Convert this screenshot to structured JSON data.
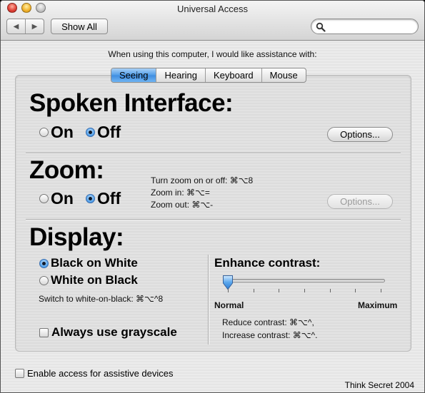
{
  "window": {
    "title": "Universal Access"
  },
  "toolbar": {
    "back_glyph": "◀",
    "forward_glyph": "▶",
    "show_all_label": "Show All",
    "search_placeholder": ""
  },
  "intro_text": "When using this computer, I would like assistance with:",
  "tabs": [
    {
      "label": "Seeing",
      "active": true
    },
    {
      "label": "Hearing",
      "active": false
    },
    {
      "label": "Keyboard",
      "active": false
    },
    {
      "label": "Mouse",
      "active": false
    }
  ],
  "spoken_interface": {
    "heading": "Spoken Interface:",
    "on_label": "On",
    "off_label": "Off",
    "selected": "off",
    "options_label": "Options..."
  },
  "zoom": {
    "heading": "Zoom:",
    "on_label": "On",
    "off_label": "Off",
    "selected": "off",
    "shortcut_toggle": "Turn zoom on or off: ⌘⌥8",
    "shortcut_in": "Zoom in: ⌘⌥=",
    "shortcut_out": "Zoom out: ⌘⌥-",
    "options_label": "Options...",
    "options_enabled": false
  },
  "display": {
    "heading": "Display:",
    "black_on_white_label": "Black on White",
    "white_on_black_label": "White on Black",
    "selected": "black-on-white",
    "switch_shortcut": "Switch to white-on-black: ⌘⌥^8",
    "grayscale_label": "Always use grayscale",
    "grayscale_checked": false
  },
  "enhance_contrast": {
    "heading": "Enhance contrast:",
    "min_label": "Normal",
    "max_label": "Maximum",
    "value": 0,
    "reduce_shortcut": "Reduce contrast: ⌘⌥^,",
    "increase_shortcut": "Increase contrast: ⌘⌥^."
  },
  "footer": {
    "assistive_label": "Enable access for assistive devices",
    "assistive_checked": false,
    "credit": "Think Secret 2004"
  },
  "colors": {
    "selected_tab": "#4f9ce8",
    "radio_selected": "#2f7ed4"
  }
}
